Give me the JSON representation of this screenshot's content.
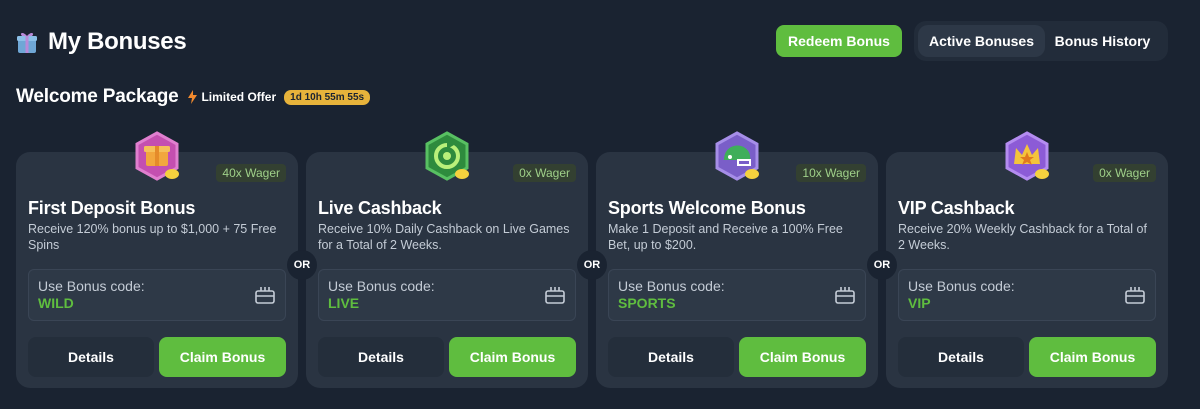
{
  "header": {
    "title": "My Bonuses",
    "redeem_label": "Redeem Bonus",
    "tabs": [
      {
        "label": "Active Bonuses",
        "active": true
      },
      {
        "label": "Bonus History",
        "active": false
      }
    ]
  },
  "section": {
    "title": "Welcome Package",
    "offer_label": "Limited Offer",
    "timer": "1d 10h 55m 55s"
  },
  "or_label": "OR",
  "cards": [
    {
      "wager": "40x Wager",
      "title": "First Deposit Bonus",
      "description": "Receive 120% bonus up to $1,000 + 75 Free Spins",
      "code_label": "Use Bonus code:",
      "code": "WILD",
      "details_label": "Details",
      "claim_label": "Claim Bonus",
      "icon": "gift-icon"
    },
    {
      "wager": "0x Wager",
      "title": "Live Cashback",
      "description": "Receive 10% Daily Cashback on Live Games for a Total of 2 Weeks.",
      "code_label": "Use Bonus code:",
      "code": "LIVE",
      "details_label": "Details",
      "claim_label": "Claim Bonus",
      "icon": "refresh-icon"
    },
    {
      "wager": "10x Wager",
      "title": "Sports Welcome Bonus",
      "description": "Make 1 Deposit and Receive a 100% Free Bet, up to $200.",
      "code_label": "Use Bonus code:",
      "code": "SPORTS",
      "details_label": "Details",
      "claim_label": "Claim Bonus",
      "icon": "helmet-icon"
    },
    {
      "wager": "0x Wager",
      "title": "VIP Cashback",
      "description": "Receive 20% Weekly Cashback for a Total of 2 Weeks.",
      "code_label": "Use Bonus code:",
      "code": "VIP",
      "details_label": "Details",
      "claim_label": "Claim Bonus",
      "icon": "crown-icon"
    }
  ],
  "colors": {
    "background": "#1a2331",
    "card": "#2a3442",
    "accent_green": "#5fbd3f",
    "timer_yellow": "#e7b33b"
  }
}
